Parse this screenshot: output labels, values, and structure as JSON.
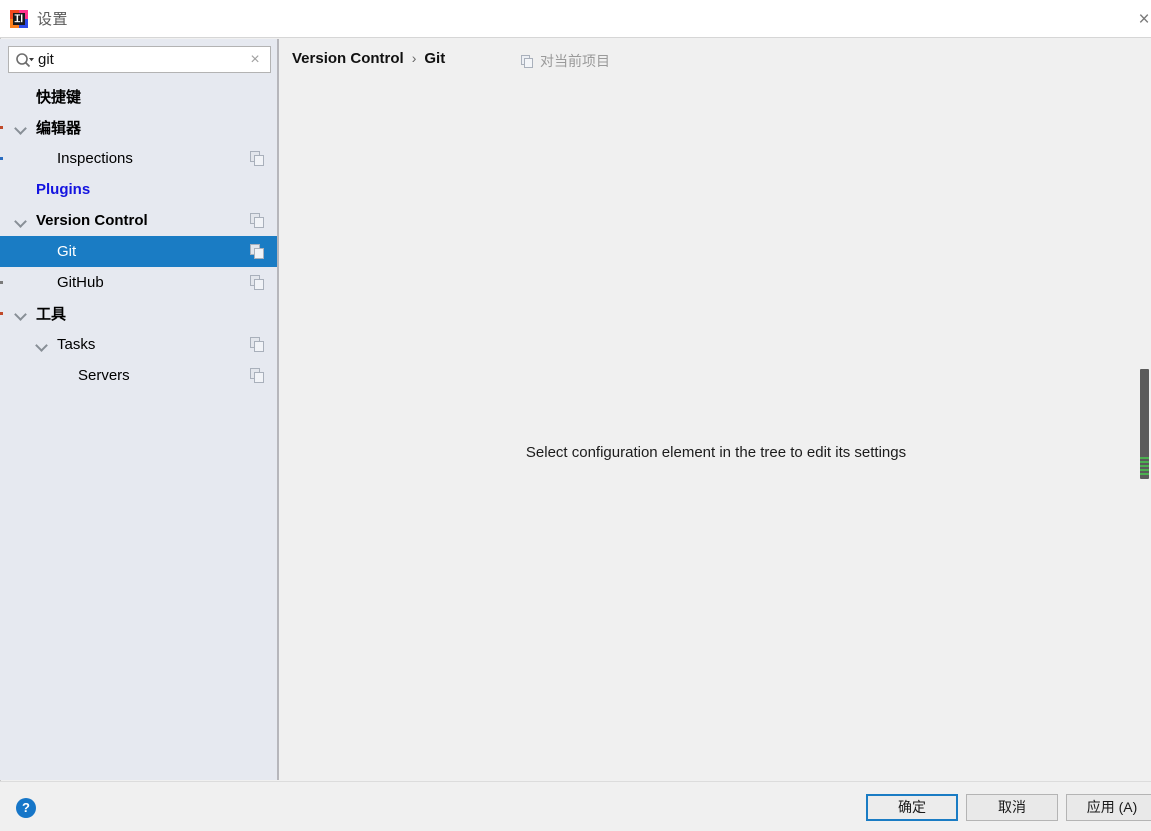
{
  "window": {
    "title": "设置",
    "app_icon": "intellij-idea-logo",
    "close_label": "×"
  },
  "search": {
    "value": "git",
    "placeholder": "",
    "icon": "search-icon",
    "clear_label": "×"
  },
  "sidebar": {
    "items": [
      {
        "label": "快捷键",
        "indent": 0,
        "arrow": "none",
        "bold": true,
        "link": false,
        "copy": false,
        "selected": false,
        "mark": ""
      },
      {
        "label": "编辑器",
        "indent": 0,
        "arrow": "open",
        "bold": true,
        "link": false,
        "copy": false,
        "selected": false,
        "mark": "#c04a2a"
      },
      {
        "label": "Inspections",
        "indent": 1,
        "arrow": "none",
        "bold": false,
        "link": false,
        "copy": true,
        "selected": false,
        "mark": "#2a6cc0"
      },
      {
        "label": "Plugins",
        "indent": 0,
        "arrow": "none",
        "bold": true,
        "link": true,
        "copy": false,
        "selected": false,
        "mark": ""
      },
      {
        "label": "Version Control",
        "indent": 0,
        "arrow": "open",
        "bold": true,
        "link": false,
        "copy": true,
        "selected": false,
        "mark": ""
      },
      {
        "label": "Git",
        "indent": 1,
        "arrow": "none",
        "bold": false,
        "link": false,
        "copy": true,
        "selected": true,
        "mark": ""
      },
      {
        "label": "GitHub",
        "indent": 1,
        "arrow": "none",
        "bold": false,
        "link": false,
        "copy": true,
        "selected": false,
        "mark": "#7a7a7a"
      },
      {
        "label": "工具",
        "indent": 0,
        "arrow": "open",
        "bold": true,
        "link": false,
        "copy": false,
        "selected": false,
        "mark": "#c04a2a"
      },
      {
        "label": "Tasks",
        "indent": 1,
        "arrow": "open",
        "bold": false,
        "link": false,
        "copy": true,
        "selected": false,
        "mark": ""
      },
      {
        "label": "Servers",
        "indent": 2,
        "arrow": "none",
        "bold": false,
        "link": false,
        "copy": true,
        "selected": false,
        "mark": ""
      }
    ]
  },
  "main": {
    "breadcrumb": {
      "parent": "Version Control",
      "separator": "›",
      "current": "Git"
    },
    "scope_hint": {
      "icon": "copy-icon",
      "label": "对当前项目"
    },
    "empty_message": "Select configuration element in the tree to edit its settings"
  },
  "scrollbar": {
    "thumb_color": "#5b5b5b",
    "marker_color": "#4caf50"
  },
  "footer": {
    "help_label": "?",
    "ok_label": "确定",
    "cancel_label": "取消",
    "apply_label": "应用 (A)"
  },
  "colors": {
    "accent": "#1a7cc4",
    "sidebar_bg": "#e6e9f0",
    "main_bg": "#f0f0f0",
    "link": "#1414e0"
  }
}
